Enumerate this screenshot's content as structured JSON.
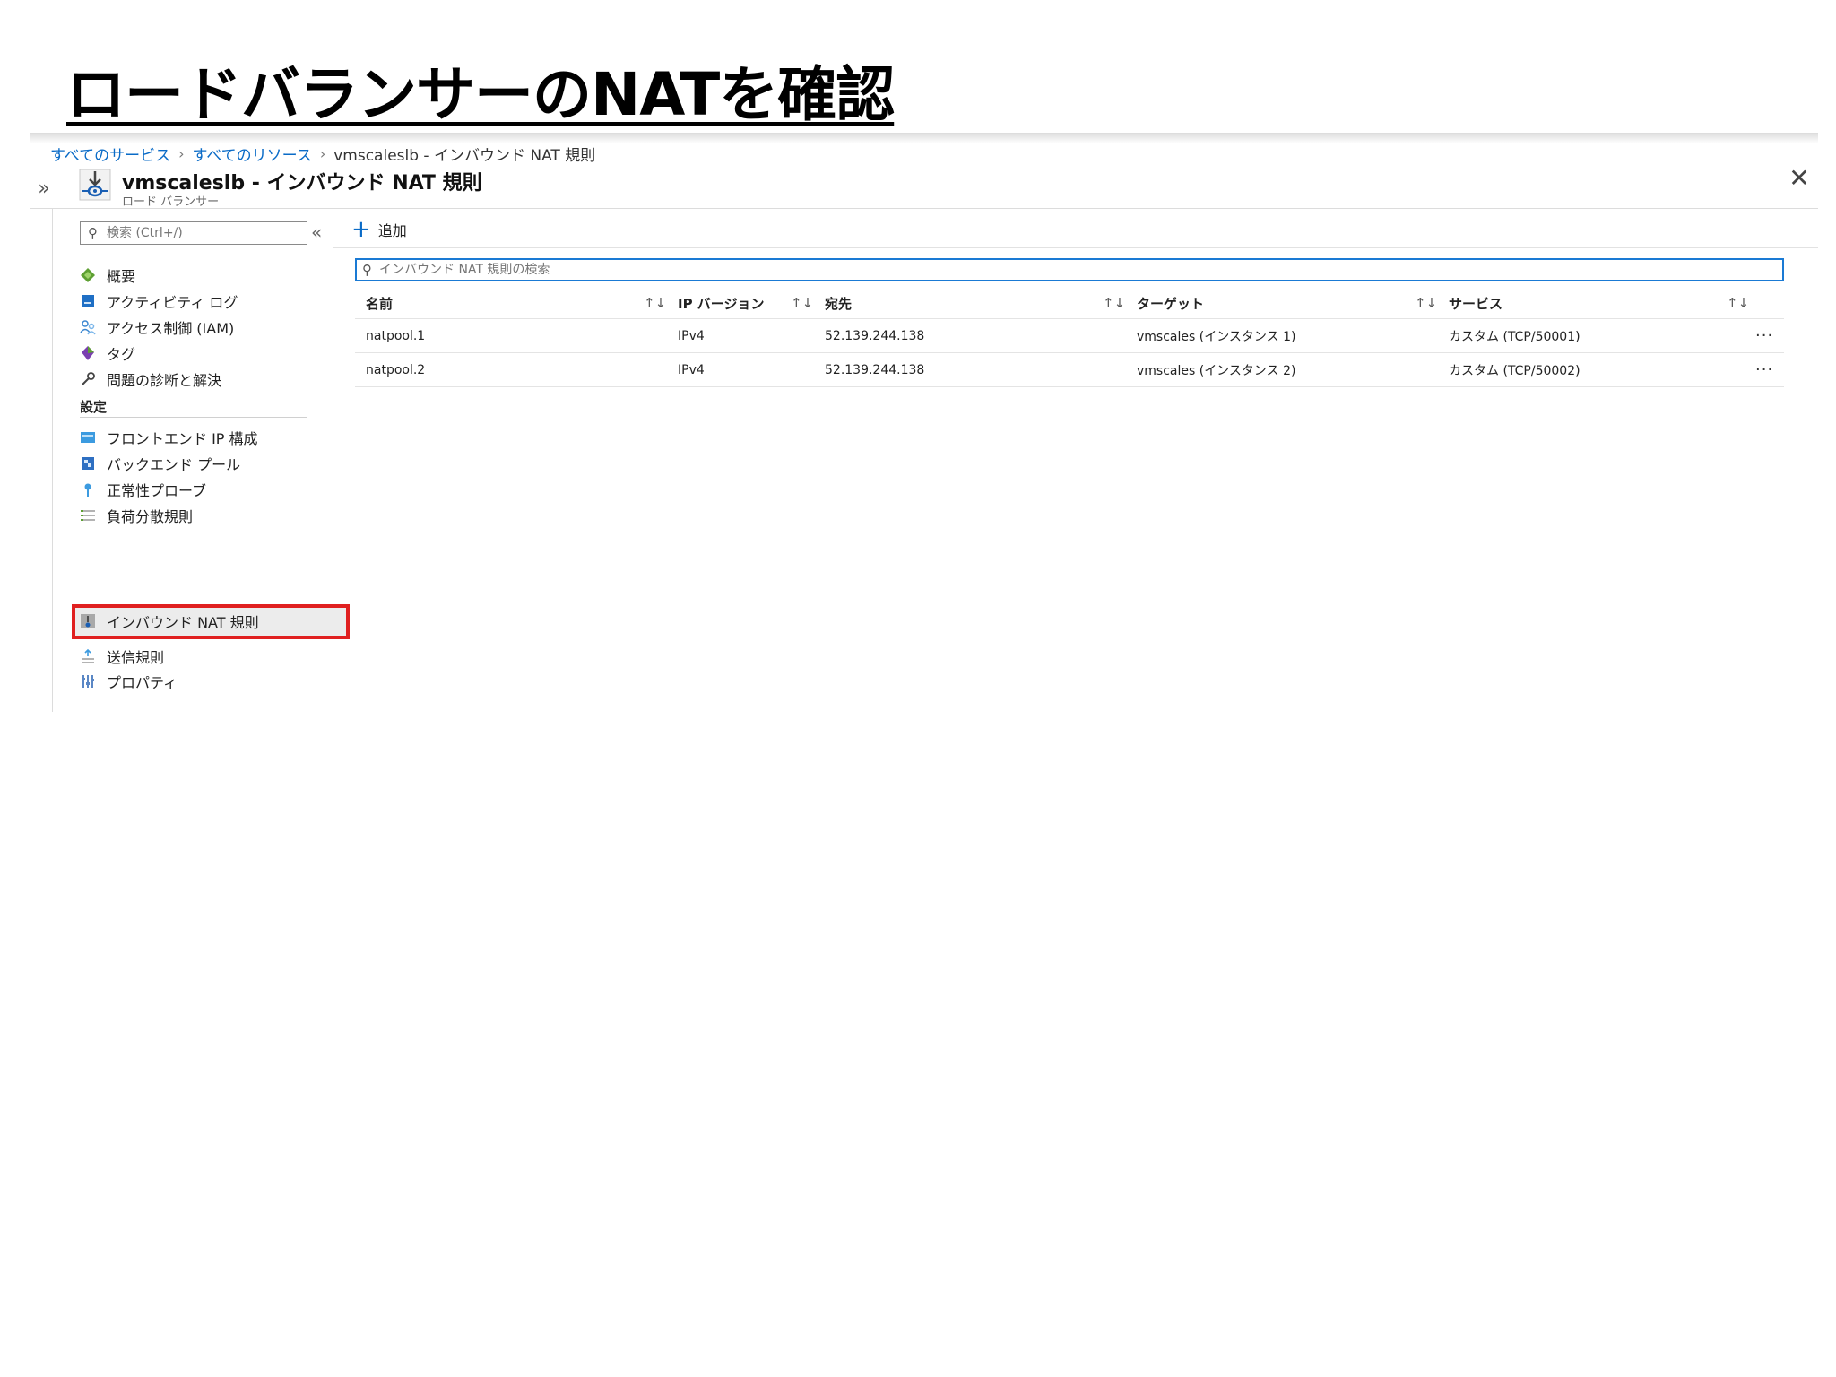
{
  "slide": {
    "title": "ロードバランサーのNATを確認"
  },
  "breadcrumb": {
    "items": [
      "すべてのサービス",
      "すべてのリソース"
    ],
    "current": "vmscaleslb - インバウンド NAT 規則"
  },
  "header": {
    "title": "vmscaleslb - インバウンド NAT 規則",
    "subtitle": "ロード バランサー",
    "close_icon": "close-icon",
    "expand_icon": "chevron-double-right-icon"
  },
  "sidebar": {
    "search_placeholder": "検索 (Ctrl+/)",
    "collapse_glyph": "«",
    "items": [
      {
        "label": "概要",
        "icon": "overview-icon"
      },
      {
        "label": "アクティビティ ログ",
        "icon": "activity-log-icon"
      },
      {
        "label": "アクセス制御 (IAM)",
        "icon": "iam-icon"
      },
      {
        "label": "タグ",
        "icon": "tag-icon"
      },
      {
        "label": "問題の診断と解決",
        "icon": "wrench-icon"
      }
    ],
    "section_label": "設定",
    "settings_items": [
      {
        "label": "フロントエンド IP 構成",
        "icon": "frontend-ip-icon"
      },
      {
        "label": "バックエンド プール",
        "icon": "backend-pool-icon"
      },
      {
        "label": "正常性プローブ",
        "icon": "health-probe-icon"
      },
      {
        "label": "負荷分散規則",
        "icon": "lb-rules-icon"
      },
      {
        "label": "インバウンド NAT 規則",
        "icon": "inbound-nat-icon",
        "selected": true
      },
      {
        "label": "送信規則",
        "icon": "outbound-rules-icon"
      },
      {
        "label": "プロパティ",
        "icon": "properties-icon"
      }
    ],
    "highlight_color": "#e02020"
  },
  "toolbar": {
    "add_label": "追加"
  },
  "table": {
    "search_placeholder": "インバウンド NAT 規則の検索",
    "columns": [
      "名前",
      "IP バージョン",
      "宛先",
      "ターゲット",
      "サービス"
    ],
    "sort_glyph": "↑↓",
    "rows": [
      {
        "name": "natpool.1",
        "ip_version": "IPv4",
        "destination": "52.139.244.138",
        "target": "vmscales (インスタンス 1)",
        "service": "カスタム (TCP/50001)"
      },
      {
        "name": "natpool.2",
        "ip_version": "IPv4",
        "destination": "52.139.244.138",
        "target": "vmscales (インスタンス 2)",
        "service": "カスタム (TCP/50002)"
      }
    ],
    "more_glyph": "···"
  },
  "colors": {
    "accent": "#0a6bc7",
    "search_border": "#1a7ad4"
  }
}
